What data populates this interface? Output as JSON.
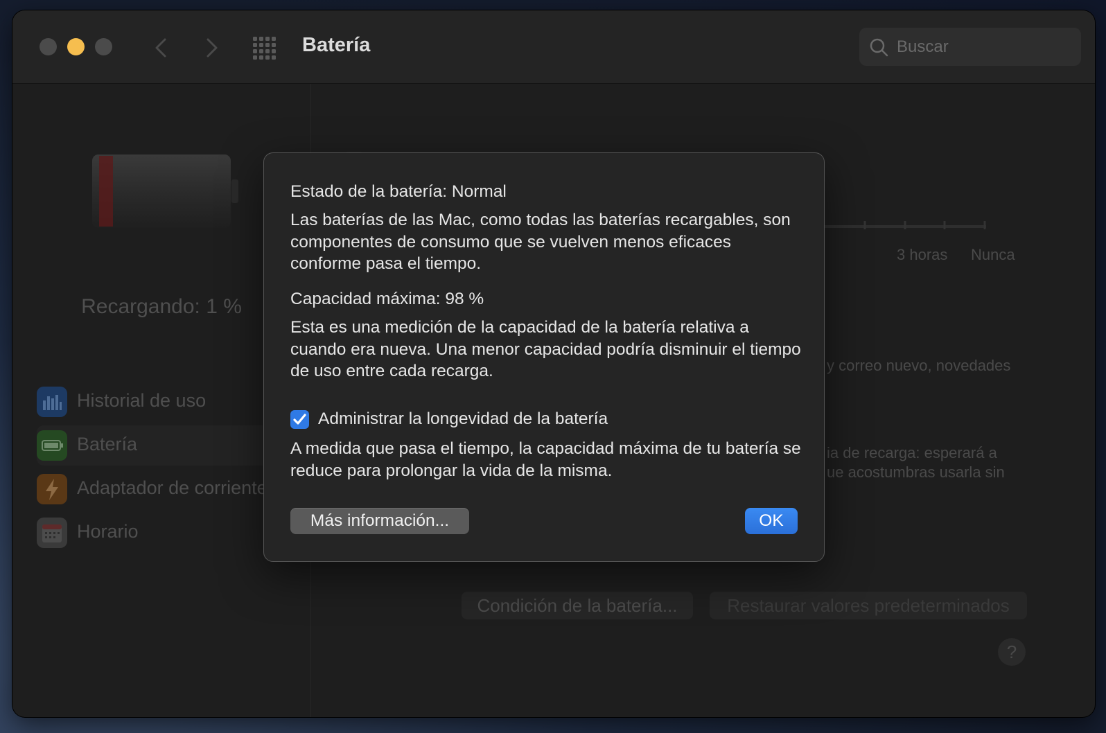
{
  "window": {
    "title": "Batería",
    "search_placeholder": "Buscar"
  },
  "sidebar": {
    "charging_status": "Recargando: 1 %",
    "items": [
      {
        "label": "Historial de uso",
        "icon": "bar-chart-icon",
        "color": "#2f66b8"
      },
      {
        "label": "Batería",
        "icon": "battery-icon",
        "color": "#3f8f3a"
      },
      {
        "label": "Adaptador de corriente",
        "icon": "bolt-icon",
        "color": "#c97a1e"
      },
      {
        "label": "Horario",
        "icon": "calendar-icon",
        "color": "#6f6f6f"
      }
    ]
  },
  "background": {
    "slider_labels": [
      "3 horas",
      "Nunca"
    ],
    "partial_text_1": "y correo nuevo, novedades",
    "partial_text_2": "ia de recarga: esperará a",
    "partial_text_3": "ue acostumbras usarla sin",
    "condition_button": "Condición de la batería...",
    "restore_button": "Restaurar valores predeterminados",
    "help_label": "?"
  },
  "dialog": {
    "status_title": "Estado de la batería: Normal",
    "status_desc": "Las baterías de las Mac, como todas las baterías recargables, son componentes de consumo que se vuelven menos eficaces conforme pasa el tiempo.",
    "capacity_title": "Capacidad máxima: 98 %",
    "capacity_desc": "Esta es una medición de la capacidad de la batería relativa a cuando era nueva. Una menor capacidad podría disminuir el tiempo de uso entre cada recarga.",
    "manage_label": "Administrar la longevidad de la batería",
    "manage_checked": true,
    "manage_desc": "A medida que pasa el tiempo, la capacidad máxima de tu batería se reduce para prolongar la vida de la misma.",
    "more_info_button": "Más información...",
    "ok_button": "OK"
  },
  "colors": {
    "accent": "#2f7ae5",
    "minimize": "#f6be4f"
  }
}
